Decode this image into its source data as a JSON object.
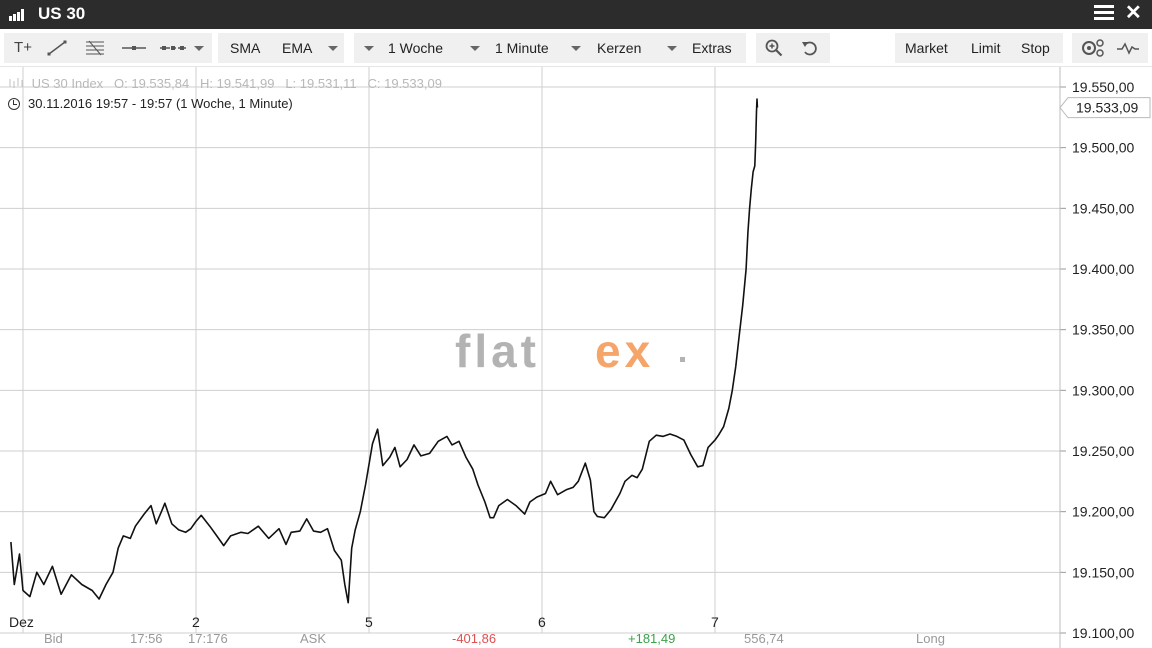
{
  "window": {
    "title": "US 30"
  },
  "toolbar": {
    "text_tool": "T+",
    "indicator_sma": "SMA",
    "indicator_ema": "EMA",
    "period": "1 Woche",
    "interval": "1 Minute",
    "chart_style": "Kerzen",
    "extras": "Extras",
    "order_market": "Market",
    "order_limit": "Limit",
    "order_stop": "Stop"
  },
  "info": {
    "instrument": "US 30 Index",
    "open": "O: 19.535,84",
    "high": "H: 19.541,99",
    "low": "L: 19.531,11",
    "close": "C: 19.533,09",
    "timestamp": "30.11.2016 19:57 - 19:57 (1 Woche, 1 Minute)"
  },
  "watermark": {
    "brand": "flatex",
    "colors": {
      "gray": "#b3b3b3",
      "orange": "#f5a46a"
    }
  },
  "chart_data": {
    "type": "line",
    "y_axis": {
      "range": [
        19100,
        19560
      ],
      "ticks": [
        19550,
        19500,
        19450,
        19400,
        19350,
        19300,
        19250,
        19200,
        19150,
        19100
      ],
      "tick_labels": [
        "19.550,00",
        "19.500,00",
        "19.450,00",
        "19.400,00",
        "19.350,00",
        "19.300,00",
        "19.250,00",
        "19.200,00",
        "19.150,00",
        "19.100,00"
      ]
    },
    "x_axis": {
      "ticks": [
        0,
        1,
        2,
        3,
        4
      ],
      "tick_labels": [
        "Dez",
        "2",
        "5",
        "6",
        "7"
      ],
      "range": [
        0,
        4.85
      ]
    },
    "last_price_label": "19.533,09",
    "series": [
      {
        "values": [
          [
            -0.07,
            19175
          ],
          [
            -0.05,
            19140
          ],
          [
            -0.02,
            19165
          ],
          [
            0.0,
            19135
          ],
          [
            0.04,
            19130
          ],
          [
            0.08,
            19150
          ],
          [
            0.12,
            19140
          ],
          [
            0.17,
            19155
          ],
          [
            0.22,
            19132
          ],
          [
            0.28,
            19148
          ],
          [
            0.34,
            19140
          ],
          [
            0.4,
            19135
          ],
          [
            0.44,
            19128
          ],
          [
            0.48,
            19140
          ],
          [
            0.52,
            19150
          ],
          [
            0.55,
            19170
          ],
          [
            0.58,
            19180
          ],
          [
            0.62,
            19178
          ],
          [
            0.65,
            19188
          ],
          [
            0.7,
            19198
          ],
          [
            0.74,
            19205
          ],
          [
            0.77,
            19190
          ],
          [
            0.8,
            19200
          ],
          [
            0.82,
            19207
          ],
          [
            0.86,
            19190
          ],
          [
            0.9,
            19185
          ],
          [
            0.94,
            19183
          ],
          [
            0.97,
            19186
          ],
          [
            1.0,
            19192
          ],
          [
            1.03,
            19197
          ],
          [
            1.08,
            19188
          ],
          [
            1.12,
            19180
          ],
          [
            1.16,
            19172
          ],
          [
            1.2,
            19180
          ],
          [
            1.26,
            19183
          ],
          [
            1.3,
            19182
          ],
          [
            1.36,
            19188
          ],
          [
            1.42,
            19178
          ],
          [
            1.48,
            19186
          ],
          [
            1.52,
            19173
          ],
          [
            1.55,
            19183
          ],
          [
            1.6,
            19184
          ],
          [
            1.64,
            19194
          ],
          [
            1.68,
            19184
          ],
          [
            1.72,
            19183
          ],
          [
            1.76,
            19186
          ],
          [
            1.8,
            19168
          ],
          [
            1.84,
            19160
          ],
          [
            1.86,
            19140
          ],
          [
            1.88,
            19125
          ],
          [
            1.9,
            19170
          ],
          [
            1.92,
            19185
          ],
          [
            1.95,
            19200
          ],
          [
            1.98,
            19222
          ],
          [
            2.02,
            19256
          ],
          [
            2.05,
            19268
          ],
          [
            2.08,
            19238
          ],
          [
            2.12,
            19245
          ],
          [
            2.15,
            19253
          ],
          [
            2.18,
            19237
          ],
          [
            2.22,
            19243
          ],
          [
            2.26,
            19255
          ],
          [
            2.3,
            19246
          ],
          [
            2.35,
            19248
          ],
          [
            2.4,
            19258
          ],
          [
            2.45,
            19262
          ],
          [
            2.48,
            19255
          ],
          [
            2.52,
            19258
          ],
          [
            2.56,
            19245
          ],
          [
            2.6,
            19235
          ],
          [
            2.63,
            19222
          ],
          [
            2.67,
            19208
          ],
          [
            2.7,
            19195
          ],
          [
            2.72,
            19195
          ],
          [
            2.75,
            19205
          ],
          [
            2.8,
            19210
          ],
          [
            2.85,
            19205
          ],
          [
            2.9,
            19198
          ],
          [
            2.93,
            19208
          ],
          [
            2.97,
            19212
          ],
          [
            3.02,
            19215
          ],
          [
            3.05,
            19225
          ],
          [
            3.09,
            19214
          ],
          [
            3.14,
            19218
          ],
          [
            3.18,
            19220
          ],
          [
            3.21,
            19225
          ],
          [
            3.25,
            19240
          ],
          [
            3.28,
            19226
          ],
          [
            3.3,
            19200
          ],
          [
            3.32,
            19196
          ],
          [
            3.36,
            19195
          ],
          [
            3.4,
            19202
          ],
          [
            3.45,
            19215
          ],
          [
            3.48,
            19225
          ],
          [
            3.52,
            19230
          ],
          [
            3.55,
            19228
          ],
          [
            3.58,
            19235
          ],
          [
            3.62,
            19258
          ],
          [
            3.66,
            19263
          ],
          [
            3.7,
            19262
          ],
          [
            3.74,
            19264
          ],
          [
            3.78,
            19262
          ],
          [
            3.82,
            19259
          ],
          [
            3.86,
            19247
          ],
          [
            3.9,
            19237
          ],
          [
            3.93,
            19238
          ],
          [
            3.96,
            19253
          ],
          [
            4.0,
            19259
          ],
          [
            4.02,
            19263
          ],
          [
            4.05,
            19270
          ],
          [
            4.08,
            19285
          ],
          [
            4.1,
            19300
          ],
          [
            4.12,
            19320
          ],
          [
            4.14,
            19345
          ],
          [
            4.16,
            19370
          ],
          [
            4.18,
            19400
          ],
          [
            4.19,
            19430
          ],
          [
            4.2,
            19450
          ],
          [
            4.21,
            19466
          ],
          [
            4.22,
            19480
          ],
          [
            4.23,
            19485
          ],
          [
            4.235,
            19505
          ],
          [
            4.24,
            19530
          ],
          [
            4.243,
            19540
          ],
          [
            4.245,
            19533
          ]
        ]
      }
    ]
  },
  "bottom_strip": {
    "c1": "Bid",
    "c2": "17:56",
    "c3": "17:176",
    "c4": "ASK",
    "c5": "-401,86",
    "c6": "+181,49",
    "c7": "556,74",
    "c8": "Long",
    "colors": {
      "neg": "#e05050",
      "pos": "#3aa34a"
    }
  }
}
